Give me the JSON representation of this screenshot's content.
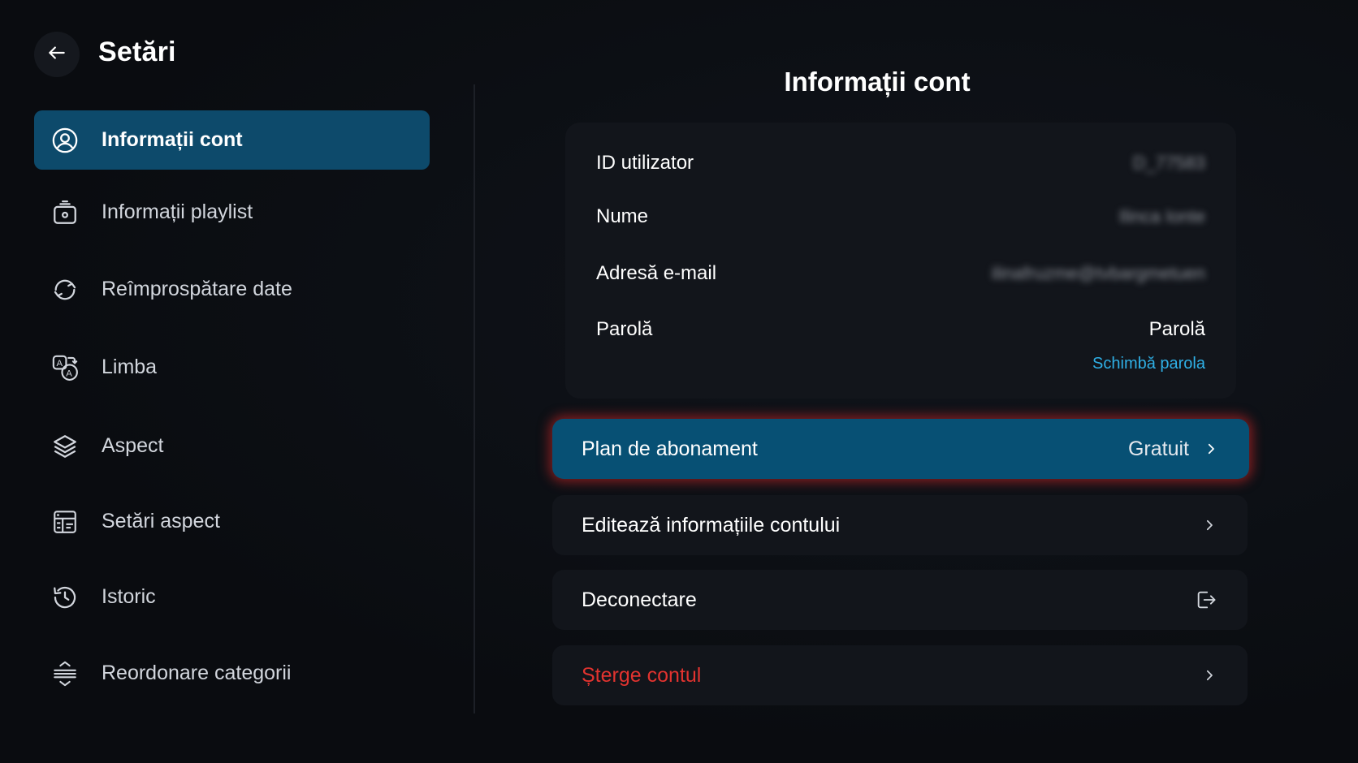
{
  "header": {
    "title": "Setări",
    "back_icon": "arrow-left-icon"
  },
  "sidebar": {
    "items": [
      {
        "label": "Informații cont",
        "icon": "user-circle-icon",
        "active": true
      },
      {
        "label": "Informații playlist",
        "icon": "tv-playlist-icon",
        "active": false
      },
      {
        "label": "Reîmprospătare date",
        "icon": "refresh-icon",
        "active": false
      },
      {
        "label": "Limba",
        "icon": "language-icon",
        "active": false
      },
      {
        "label": "Aspect",
        "icon": "layers-icon",
        "active": false
      },
      {
        "label": "Setări aspect",
        "icon": "layout-settings-icon",
        "active": false
      },
      {
        "label": "Istoric",
        "icon": "history-icon",
        "active": false
      },
      {
        "label": "Reordonare categorii",
        "icon": "reorder-icon",
        "active": false
      }
    ]
  },
  "main": {
    "title": "Informații cont",
    "account": {
      "user_id_label": "ID utilizator",
      "user_id_value": "D_77583",
      "name_label": "Nume",
      "name_value": "Ilinca Ionte",
      "email_label": "Adresă e-mail",
      "email_value": "ilinafruzme@tvbargmetuen",
      "password_label": "Parolă",
      "password_value": "Parolă",
      "change_password": "Schimbă parola"
    },
    "actions": {
      "plan_label": "Plan de abonament",
      "plan_value": "Gratuit",
      "edit_label": "Editează informațiile contului",
      "logout_label": "Deconectare",
      "delete_label": "Șterge contul"
    }
  },
  "colors": {
    "background": "#0b0d12",
    "active_blue": "#0d4a6b",
    "focus_glow": "#dc2828",
    "link": "#2fb0e6",
    "danger": "#e2332f"
  }
}
